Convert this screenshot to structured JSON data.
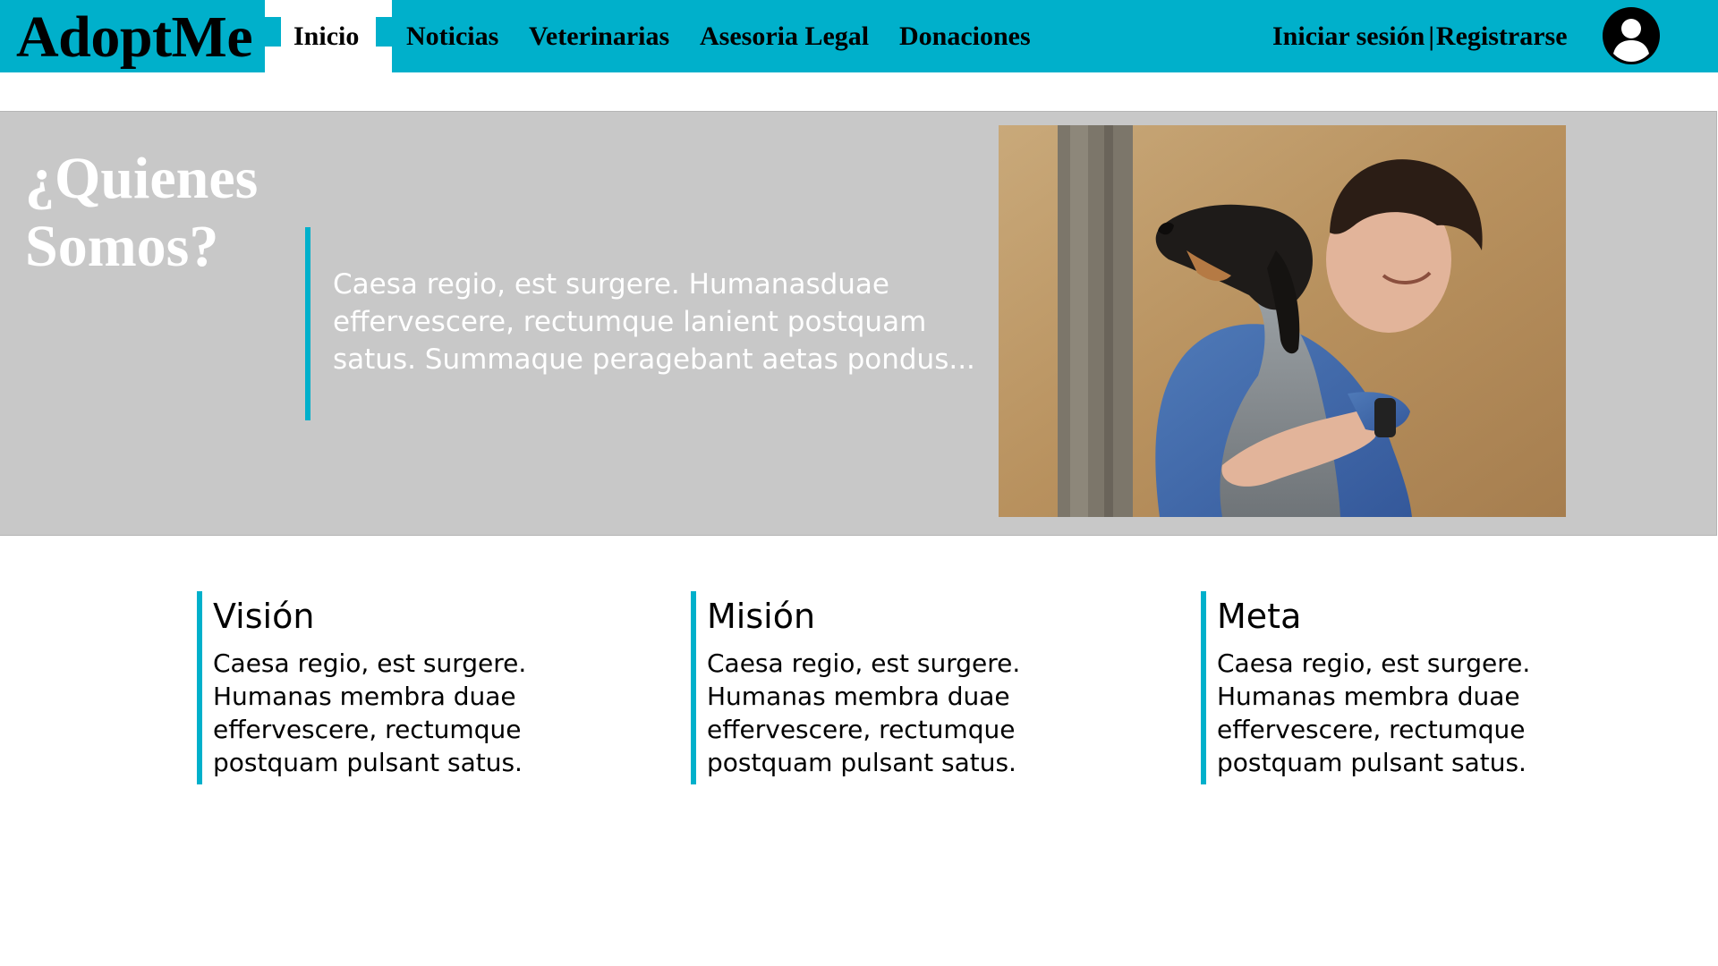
{
  "header": {
    "brand": "AdoptMe",
    "nav": {
      "inicio": "Inicio",
      "noticias": "Noticias",
      "veterinarias": "Veterinarias",
      "asesoria": "Asesoria Legal",
      "donaciones": "Donaciones"
    },
    "auth": {
      "login": "Iniciar sesión",
      "separator": "|",
      "register": "Registrarse"
    },
    "avatar_icon": "user-avatar-icon"
  },
  "hero": {
    "title": "¿Quienes Somos?",
    "text": "Caesa regio, est surgere. Humanasduae effervescere, rectumque lanient postquam satus. Summaque peragebant aetas pondus...",
    "image": "man-hugging-dog-photo"
  },
  "cards": [
    {
      "title": "Visión",
      "text": "Caesa regio, est surgere. Humanas membra duae effervescere, rectumque postquam pulsant satus."
    },
    {
      "title": "Misión",
      "text": "Caesa regio, est surgere. Humanas membra duae effervescere, rectumque postquam pulsant satus."
    },
    {
      "title": "Meta",
      "text": "Caesa regio, est surgere. Humanas membra duae effervescere, rectumque postquam pulsant satus."
    }
  ],
  "colors": {
    "accent": "#00b0cb",
    "hero_bg": "#c8c8c8"
  }
}
